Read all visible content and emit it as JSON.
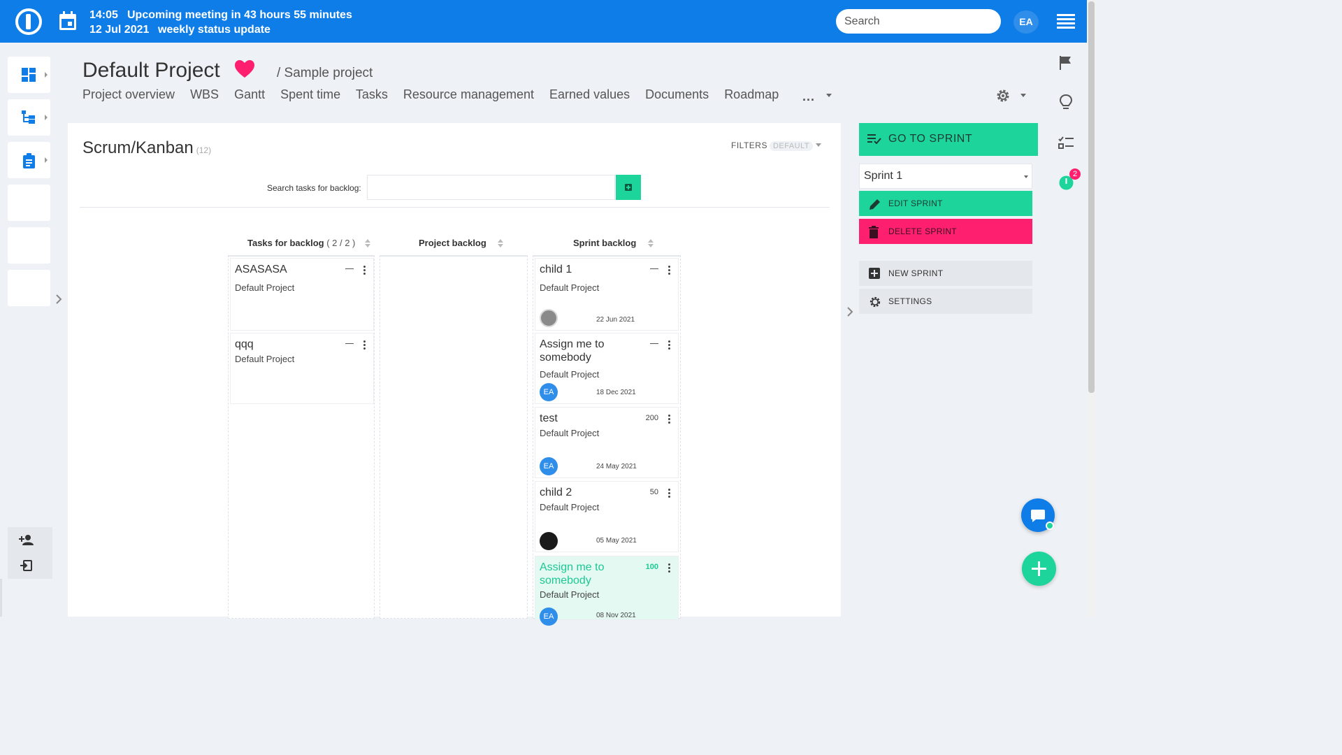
{
  "topbar": {
    "time": "14:05",
    "meeting": "Upcoming meeting in 43 hours 55 minutes",
    "date": "12 Jul 2021",
    "meeting_name": "weekly status update",
    "search_placeholder": "Search",
    "user_initials": "EA"
  },
  "project": {
    "title": "Default Project",
    "parent": "/ Sample project"
  },
  "menu": [
    "Project overview",
    "WBS",
    "Gantt",
    "Spent time",
    "Tasks",
    "Resource management",
    "Earned values",
    "Documents",
    "Roadmap"
  ],
  "menu_more": "...",
  "board": {
    "title": "Scrum/Kanban",
    "count": "(12)",
    "filters_label": "FILTERS",
    "filters_value": "DEFAULT",
    "search_label": "Search tasks for backlog:",
    "columns": [
      {
        "title": "Tasks for backlog",
        "count": "( 2 / 2 )"
      },
      {
        "title": "Project backlog",
        "count": ""
      },
      {
        "title": "Sprint backlog",
        "count": ""
      }
    ],
    "backlog_cards": [
      {
        "title": "ASASASA",
        "project": "Default Project"
      },
      {
        "title": "qqq",
        "project": "Default Project"
      }
    ],
    "sprint_cards": [
      {
        "title": "child 1",
        "project": "Default Project",
        "date": "22 Jun 2021",
        "number": "",
        "avatar": ""
      },
      {
        "title": "Assign me to somebody",
        "project": "Default Project",
        "date": "18 Dec 2021",
        "number": "",
        "avatar": "EA"
      },
      {
        "title": "test",
        "project": "Default Project",
        "date": "24 May 2021",
        "number": "200",
        "avatar": "EA"
      },
      {
        "title": "child 2",
        "project": "Default Project",
        "date": "05 May 2021",
        "number": "50",
        "avatar": ""
      },
      {
        "title": "Assign me to somebody",
        "project": "Default Project",
        "date": "08 Nov 2021",
        "number": "100",
        "avatar": "EA"
      }
    ]
  },
  "sprint_panel": {
    "go_to_sprint": "GO TO SPRINT",
    "selected_sprint": "Sprint 1",
    "edit": "EDIT SPRINT",
    "delete": "DELETE SPRINT",
    "new": "NEW SPRINT",
    "settings": "SETTINGS"
  },
  "timer_badge": "2",
  "colors": {
    "brand": "#0f7de8",
    "accent": "#1dd49a",
    "danger": "#fe1f6f",
    "heart": "#fe1f6f"
  },
  "icons": [
    "logo-icon",
    "calendar-icon",
    "hamburger-icon",
    "dashboard-icon",
    "tree-icon",
    "clipboard-icon",
    "heart-icon",
    "gear-icon",
    "flag-icon",
    "lightbulb-icon",
    "checklist-icon",
    "timer-icon",
    "chat-icon",
    "plus-icon",
    "add-user-icon",
    "logout-icon"
  ]
}
